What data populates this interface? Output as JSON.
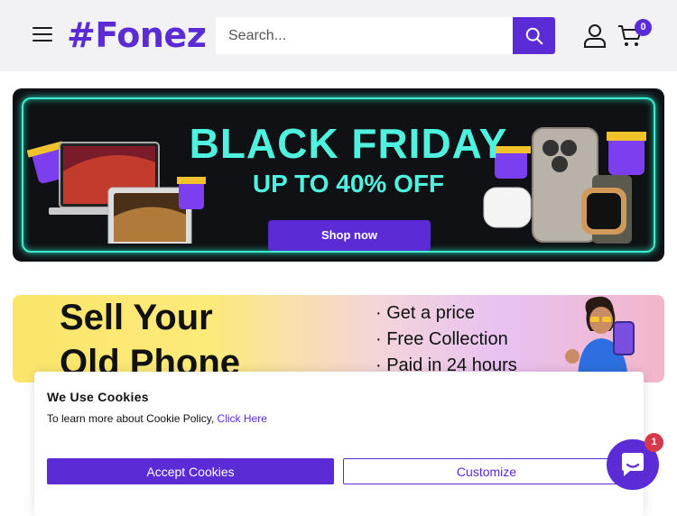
{
  "header": {
    "logo_text": "#Fonez",
    "search_placeholder": "Search...",
    "cart_count": "0",
    "icons": {
      "menu": "hamburger-icon",
      "search": "search-icon",
      "account": "user-icon",
      "cart": "cart-icon"
    }
  },
  "black_friday_banner": {
    "title": "BLACK FRIDAY",
    "subtitle": "UP TO 40% OFF",
    "button_label": "Shop now"
  },
  "sell_banner": {
    "title_line1": "Sell Your",
    "title_line2": "Old Phone",
    "points": [
      "· Get a price",
      "· Free Collection",
      "· Paid in 24 hours"
    ]
  },
  "cookie_popup": {
    "title": "We Use Cookies",
    "text": "To learn more about Cookie Policy, ",
    "link_text": "Click Here",
    "accept_label": "Accept Cookies",
    "customize_label": "Customize"
  },
  "chat": {
    "badge_count": "1",
    "icon": "chat-icon"
  },
  "colors": {
    "brand": "#5b2bd6",
    "banner_text": "#4ff2df",
    "header_bg": "#f2f1f4",
    "chat_badge": "#d63a4a"
  }
}
